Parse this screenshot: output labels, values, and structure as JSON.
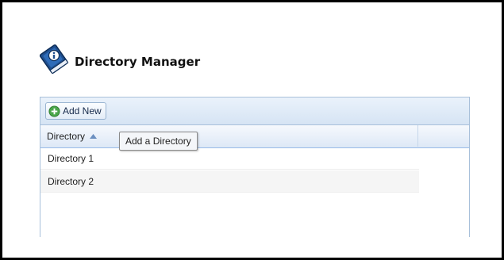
{
  "app": {
    "title": "Directory Manager",
    "icon": "book-info-icon"
  },
  "toolbar": {
    "add_label": "Add New",
    "add_icon": "plus-circle-icon"
  },
  "grid": {
    "columns": [
      {
        "label": "Directory",
        "sort": "ascending",
        "sort_icon": "sort-asc-icon"
      }
    ],
    "rows": [
      {
        "directory": "Directory 1"
      },
      {
        "directory": "Directory 2"
      }
    ]
  },
  "tooltip": {
    "text": "Add a Directory"
  },
  "colors": {
    "panel_border": "#a8c0da",
    "toolbar_bg": "#d6e4f4",
    "add_icon_green": "#4aa64a",
    "row_alt": "#f5f5f5"
  }
}
